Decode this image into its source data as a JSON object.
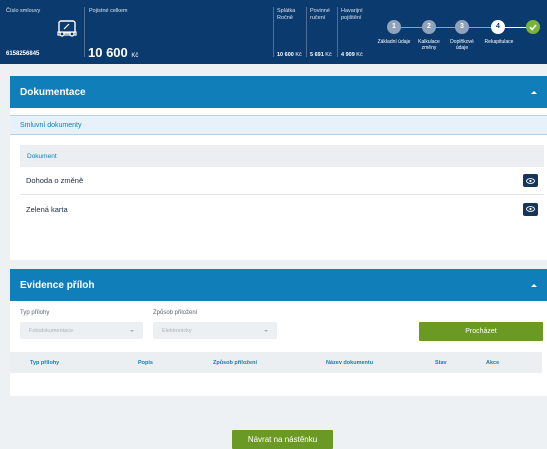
{
  "header": {
    "contract_number_label": "Číslo smlouvy",
    "contract_number": "6158256845",
    "premium_total_label": "Pojistné celkem",
    "premium_total_value": "10 600",
    "premium_total_currency": "Kč",
    "annual_installment_label": "Splátka Ročně",
    "annual_installment_value": "10 600",
    "annual_installment_currency": "Kč",
    "mandatory_liability_label": "Povinné ručení",
    "mandatory_liability_value": "5 691",
    "mandatory_liability_currency": "Kč",
    "accident_insurance_label": "Havarijní pojištění",
    "accident_insurance_value": "4 909",
    "accident_insurance_currency": "Kč",
    "vehicle_icon": "car-icon"
  },
  "stepper": {
    "steps": [
      {
        "number": "1",
        "label": "Základní údaje",
        "state": "pending"
      },
      {
        "number": "2",
        "label": "Kalkulace změny",
        "state": "pending"
      },
      {
        "number": "3",
        "label": "Doplňkové údaje",
        "state": "pending"
      },
      {
        "number": "4",
        "label": "Rekapitulace",
        "state": "active"
      }
    ],
    "done_icon": "check-icon"
  },
  "documentation": {
    "title": "Dokumentace",
    "subsection": "Smluvní dokumenty",
    "column_header": "Dokument",
    "documents": [
      {
        "name": "Dohoda o změně",
        "action_icon": "eye-icon"
      },
      {
        "name": "Zelená karta",
        "action_icon": "eye-icon"
      }
    ]
  },
  "attachments": {
    "title": "Evidence příloh",
    "type_label": "Typ přílohy",
    "type_value": "Fotodokumentace",
    "method_label": "Způsob přiložení",
    "method_value": "Elektronicky",
    "browse_button": "Procházet",
    "columns": [
      "Typ přílohy",
      "Popis",
      "Způsob přiložení",
      "Název dokumentu",
      "Stav",
      "Akce"
    ]
  },
  "footer": {
    "back_button": "Návrat na nástěnku"
  },
  "colors": {
    "header_bg": "#0b3b6e",
    "section_header": "#107fb9",
    "primary_green": "#6a9a23",
    "done_green": "#7ab33a",
    "dark_button": "#15355a"
  }
}
